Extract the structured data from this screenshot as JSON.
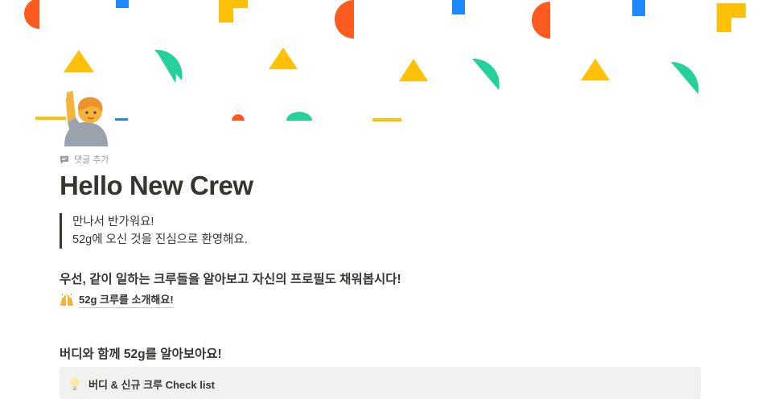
{
  "cover": {
    "colors": {
      "orange": "#ff5a1f",
      "blue": "#1e88ff",
      "yellow": "#ffc107",
      "green": "#26d09a"
    }
  },
  "page": {
    "icon": "person-raising-hand-emoji",
    "comment_label": "댓글 추가",
    "title": "Hello New Crew",
    "quote_lines": [
      "만나서 반가워요!",
      "52g에 오신 것을 진심으로 환영해요."
    ],
    "heading1": "우선, 같이 일하는 크루들을 알아보고 자신의 프로필도 채워봅시다!",
    "crew_link": {
      "icon": "raising-hands-emoji",
      "label": "52g 크루를 소개해요!"
    },
    "heading2": "버디와 함께 52g를 알아보아요!",
    "callout": {
      "icon": "lightbulb-icon",
      "label": "버디 & 신규 크루 Check list",
      "background": "#f1f1ef"
    }
  }
}
